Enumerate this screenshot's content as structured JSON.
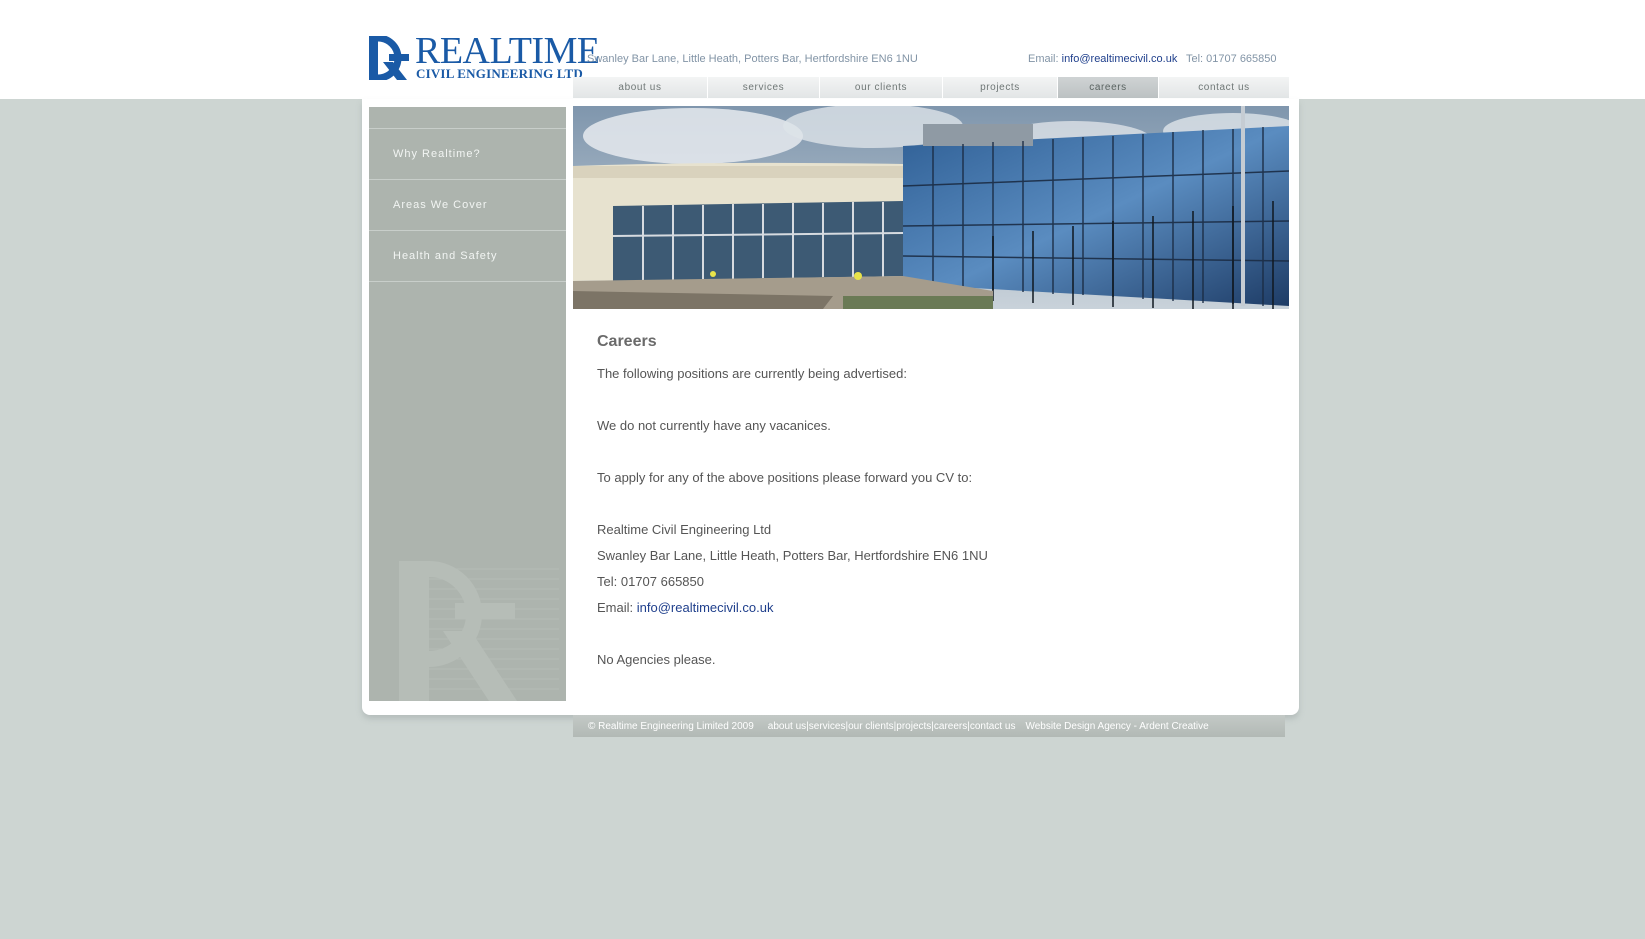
{
  "logo": {
    "title": "REALTIME",
    "subtitle": "CIVIL ENGINEERING LTD",
    "mark": "rce-logo-mark"
  },
  "header": {
    "address": "Swanley Bar Lane, Little Heath, Potters Bar, Hertfordshire EN6 1NU",
    "email_label": "Email:",
    "email": "info@realtimecivil.co.uk",
    "tel": "Tel: 01707 665850"
  },
  "nav": {
    "items": [
      {
        "label": "about us"
      },
      {
        "label": "services"
      },
      {
        "label": "our clients"
      },
      {
        "label": "projects"
      },
      {
        "label": "careers",
        "active": true
      },
      {
        "label": "contact us"
      }
    ]
  },
  "sidebar": {
    "items": [
      {
        "label": "Why Realtime?"
      },
      {
        "label": "Areas We Cover"
      },
      {
        "label": "Health and Safety"
      }
    ]
  },
  "content": {
    "heading": "Careers",
    "intro": "The following positions are currently being advertised:",
    "no_vacancies": "We do not currently have any vacanices.",
    "apply": "To apply for any of the above positions please forward you CV to:",
    "company": "Realtime Civil Engineering Ltd",
    "address": "Swanley Bar Lane, Little Heath, Potters Bar, Hertfordshire EN6 1NU",
    "tel": "Tel: 01707 665850",
    "email_label": "Email:",
    "email": "info@realtimecivil.co.uk",
    "no_agencies": "No Agencies please."
  },
  "footer": {
    "copyright": "© Realtime Engineering Limited 2009",
    "links": [
      "about us",
      "services",
      "our clients",
      "projects",
      "careers",
      "contact us"
    ],
    "separator": " | ",
    "agency": "Website Design Agency - Ardent Creative"
  },
  "colors": {
    "brand_blue": "#1a5aa6",
    "link_blue": "#1f3f8c",
    "sidebar": "#adb4ae",
    "page_background": "#cdd5d2"
  }
}
